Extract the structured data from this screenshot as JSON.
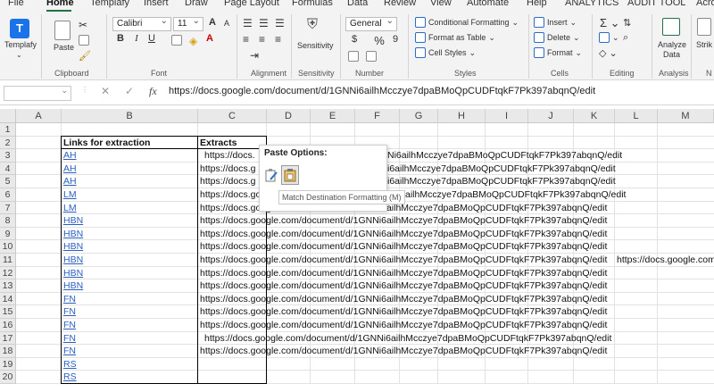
{
  "menu": [
    "File",
    "Home",
    "Templafy",
    "Insert",
    "Draw",
    "Page Layout",
    "Formulas",
    "Data",
    "Review",
    "View",
    "Automate",
    "Help",
    "ANALYTICS",
    "AUDIT TOOL",
    "Acro"
  ],
  "ribbon": {
    "templafy": "Templafy",
    "paste": "Paste",
    "font_name": "Calibri",
    "font_size": "11",
    "bold": "B",
    "italic": "I",
    "underline": "U",
    "grow_font": "A",
    "shrink_font": "A",
    "font_color_letter": "A",
    "sensitivity": "Sensitivity",
    "number_format": "General",
    "currency": "$",
    "percent": "%",
    "comma": "9",
    "conditional_formatting": "Conditional Formatting",
    "format_as_table": "Format as Table",
    "cell_styles": "Cell Styles",
    "insert": "Insert",
    "delete": "Delete",
    "format": "Format",
    "analyze_data_1": "Analyze",
    "analyze_data_2": "Data",
    "strike": "Strik",
    "groups": {
      "clipboard": "Clipboard",
      "font": "Font",
      "alignment": "Alignment",
      "sensitivity": "Sensitivity",
      "number": "Number",
      "styles": "Styles",
      "cells": "Cells",
      "editing": "Editing",
      "analysis": "Analysis",
      "extra": "N"
    }
  },
  "formula_bar": {
    "fx": "fx",
    "value": "https://docs.google.com/document/d/1GNNi6ailhMcczye7dpaBMoQpCUDFtqkF7Pk397abqnQ/edit"
  },
  "columns": [
    "A",
    "B",
    "C",
    "D",
    "E",
    "F",
    "G",
    "H",
    "I",
    "J",
    "K",
    "L",
    "M"
  ],
  "rows": [
    "1",
    "2",
    "3",
    "4",
    "5",
    "6",
    "7",
    "8",
    "9",
    "10",
    "11",
    "12",
    "13",
    "14",
    "15",
    "16",
    "17",
    "18",
    "19",
    "20"
  ],
  "header_b": "Links for extraction",
  "header_c": "Extracts",
  "links": [
    "AH",
    "AH",
    "AH",
    "LM",
    "LM",
    "HBN",
    "HBN",
    "HBN",
    "HBN",
    "HBN",
    "HBN",
    "FN",
    "FN",
    "FN",
    "FN",
    "FN",
    "RS",
    "RS"
  ],
  "url_full": "https://docs.google.com/document/d/1GNNi6ailhMcczye7dpaBMoQpCUDFtqkF7Pk397abqnQ/edit",
  "extracts": {
    "c3": "https://docs.",
    "c4": "https://docs.g",
    "c5": "https://docs.g",
    "c6": "https://docs.google",
    "tail": "i6ailhMcczye7dpaBMoQpCUDFtqkF7Pk397abqnQ/edit",
    "tail_row6": "ailhMcczye7dpaBMoQpCUDFtqkF7Pk397abqnQ/edit",
    "row3_tail": "Ni6ailhMcczye7dpaBMoQpCUDFtqkF7Pk397abqnQ/edit",
    "l12": "https://docs.google.com"
  },
  "paste_menu": {
    "title": "Paste Options:",
    "tooltip": "Match Destination Formatting (M)"
  },
  "colors": {
    "accent": "#217346",
    "link": "#2a5fbf",
    "ribbon_bg": "#f3f3f3"
  }
}
